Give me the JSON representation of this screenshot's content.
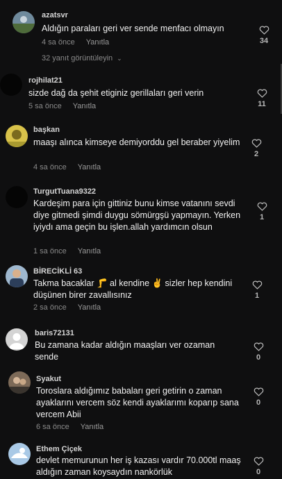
{
  "comments": [
    {
      "username": "azatsvr",
      "text": "Aldığın paraları geri ver sende menfacı olmayın",
      "time": "4 sa önce",
      "reply": "Yanıtla",
      "likes": "34"
    },
    {
      "username": "rojhilat21",
      "text": "sizde dağ da şehit etiginiz gerillaları geri verin",
      "time": "5 sa önce",
      "reply": "Yanıtla",
      "likes": "11"
    },
    {
      "username": "başkan",
      "text": "maaşı alınca kimseye demiyorddu gel beraber yiyelim",
      "time": "4 sa önce",
      "reply": "Yanıtla",
      "likes": "2"
    },
    {
      "username": "TurgutTuana9322",
      "text": "Kardeşim para için gittiniz bunu kimse vatanını sevdi diye gitmedi şimdi duygu sömürgşü yapmayın. Yerken iyiydı ama geçin bu işlen.allah yardımcın olsun",
      "time": "1 sa önce",
      "reply": "Yanıtla",
      "likes": "1"
    },
    {
      "username": "BİRECİKLİ 63",
      "text": "Takma bacaklar 🦵 al kendine ✌️ sizler hep kendini düşünen birer zavallısınız",
      "time": "2 sa önce",
      "reply": "Yanıtla",
      "likes": "1"
    },
    {
      "username": "baris72131",
      "text": "Bu zamana kadar aldığın maaşları ver ozaman sende",
      "time": "",
      "reply": "",
      "likes": "0"
    },
    {
      "username": "Syakut",
      "text": "Toroslara aldığımız babaları geri getirin o zaman ayaklarını vercem söz kendi ayaklarımı koparıp sana vercem Abii",
      "time": "6 sa önce",
      "reply": "Yanıtla",
      "likes": "0"
    },
    {
      "username": "Ethem Çiçek",
      "text": "devlet memurunun her iş kazası vardır 70.000tl maaş aldığın zaman koysaydın nankörlük",
      "time": "",
      "reply": "",
      "likes": "0"
    }
  ],
  "view_replies": "32 yanıt görüntüleyin",
  "colors": {
    "background": "#0f0f10",
    "text": "#f2f2f2",
    "muted": "#8a8a8a"
  }
}
